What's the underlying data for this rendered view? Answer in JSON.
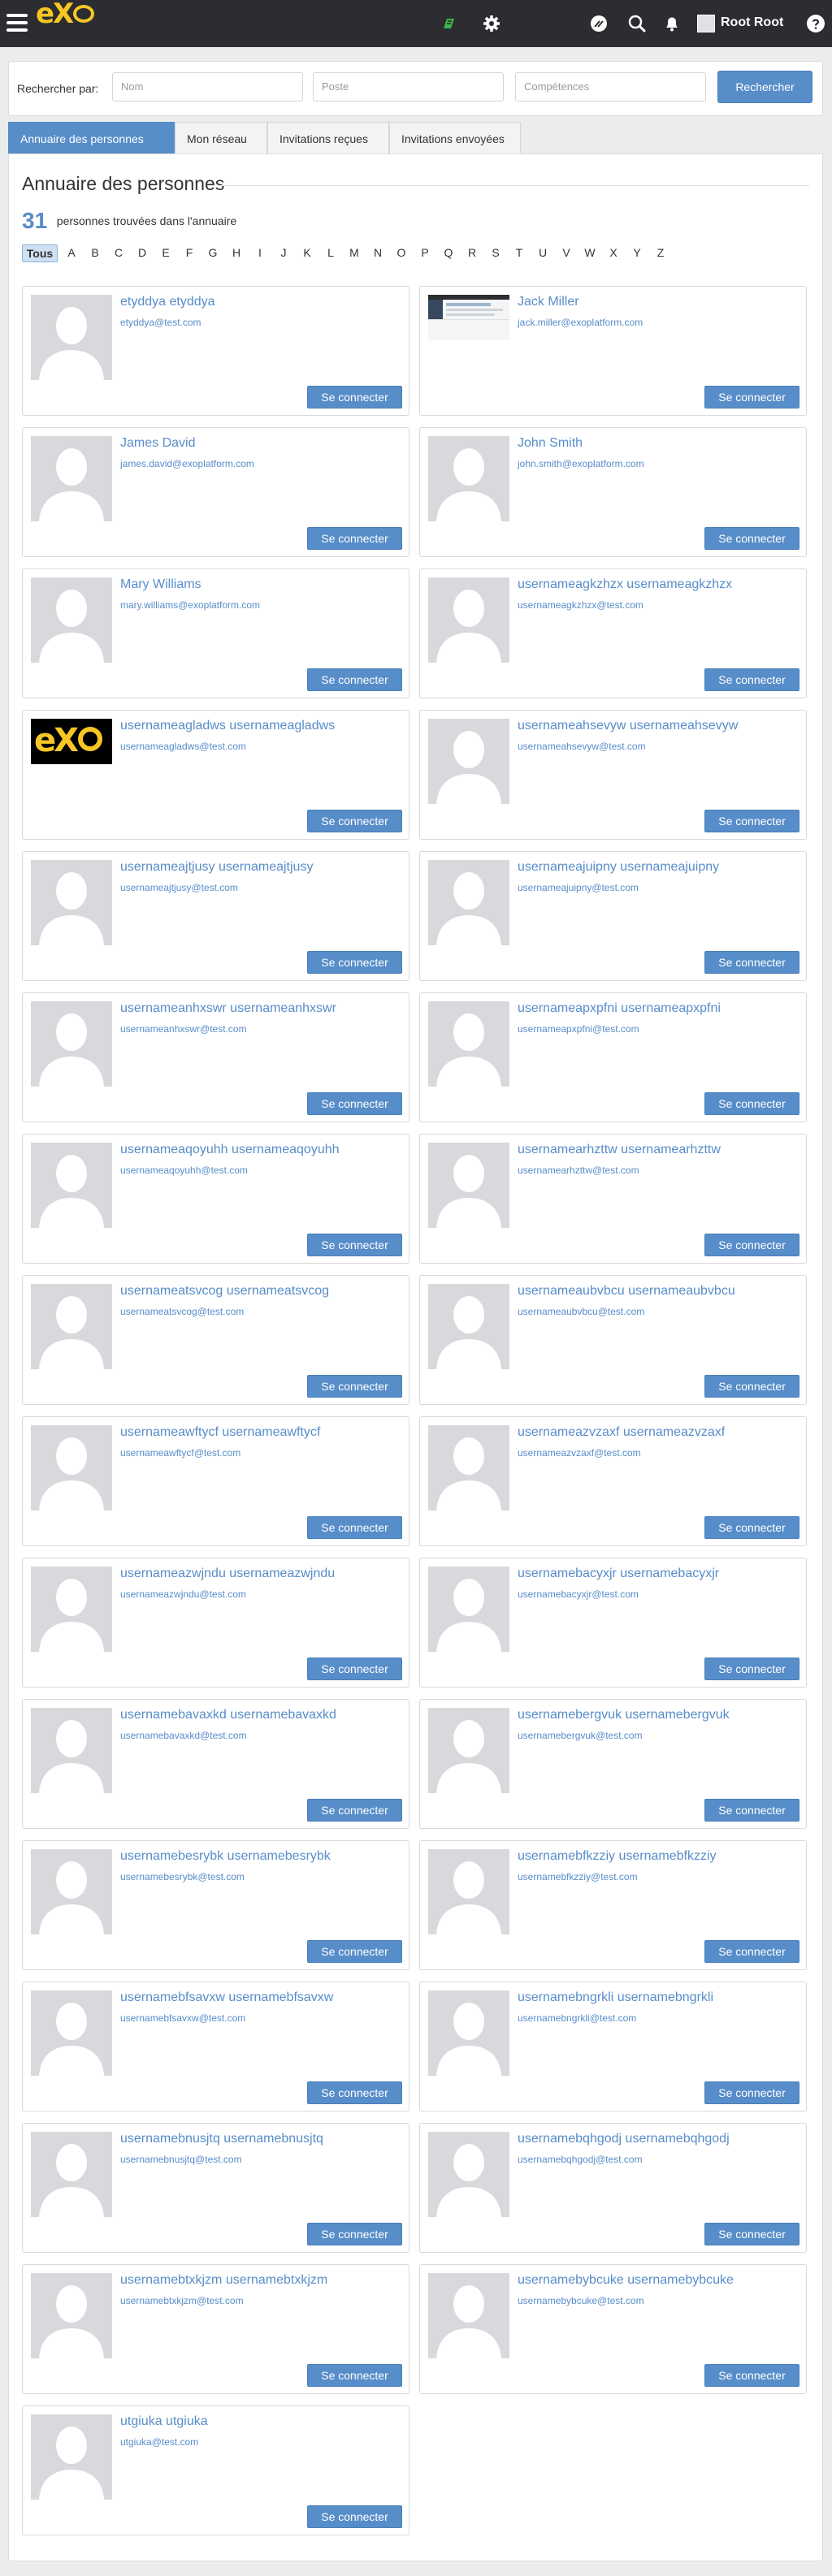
{
  "topbar": {
    "logo_text": "eX",
    "user_name": "Root Root",
    "icons": [
      "menu-icon",
      "app-badge-icon",
      "settings-icon",
      "chat-icon",
      "search-icon",
      "bell-icon",
      "help-icon"
    ],
    "colors": {
      "bar": "#2b2d31",
      "logo": "#f6c624",
      "badge": "#3bb54a"
    }
  },
  "search": {
    "label": "Rechercher par:",
    "name_placeholder": "Nom",
    "position_placeholder": "Poste",
    "skills_placeholder": "Compétences",
    "button_label": "Rechercher"
  },
  "tabs": [
    {
      "label": "Annuaire des personnes",
      "active": true
    },
    {
      "label": "Mon réseau",
      "active": false
    },
    {
      "label": "Invitations reçues",
      "active": false
    },
    {
      "label": "Invitations envoyées",
      "active": false
    }
  ],
  "directory": {
    "title": "Annuaire des personnes",
    "count": "31",
    "count_text": "personnes trouvées dans l'annuaire",
    "letters": [
      "Tous",
      "A",
      "B",
      "C",
      "D",
      "E",
      "F",
      "G",
      "H",
      "I",
      "J",
      "K",
      "L",
      "M",
      "N",
      "O",
      "P",
      "Q",
      "R",
      "S",
      "T",
      "U",
      "V",
      "W",
      "X",
      "Y",
      "Z"
    ],
    "active_letter": "Tous",
    "connect_label": "Se connecter",
    "accent_color": "#578dc9",
    "people": [
      {
        "name": "etyddya etyddya",
        "email": "etyddya@test.com",
        "avatar": "default"
      },
      {
        "name": "Jack Miller",
        "email": "jack.miller@exoplatform.com",
        "avatar": "screenshot"
      },
      {
        "name": "James David",
        "email": "james.david@exoplatform.com",
        "avatar": "default"
      },
      {
        "name": "John Smith",
        "email": "john.smith@exoplatform.com",
        "avatar": "default"
      },
      {
        "name": "Mary Williams",
        "email": "mary.williams@exoplatform.com",
        "avatar": "default"
      },
      {
        "name": "usernameagkzhzx usernameagkzhzx",
        "email": "usernameagkzhzx@test.com",
        "avatar": "default"
      },
      {
        "name": "usernameagladws usernameagladws",
        "email": "usernameagladws@test.com",
        "avatar": "exo-logo"
      },
      {
        "name": "usernameahsevyw usernameahsevyw",
        "email": "usernameahsevyw@test.com",
        "avatar": "default"
      },
      {
        "name": "usernameajtjusy usernameajtjusy",
        "email": "usernameajtjusy@test.com",
        "avatar": "default"
      },
      {
        "name": "usernameajuipny usernameajuipny",
        "email": "usernameajuipny@test.com",
        "avatar": "default"
      },
      {
        "name": "usernameanhxswr usernameanhxswr",
        "email": "usernameanhxswr@test.com",
        "avatar": "default"
      },
      {
        "name": "usernameapxpfni usernameapxpfni",
        "email": "usernameapxpfni@test.com",
        "avatar": "default"
      },
      {
        "name": "usernameaqoyuhh usernameaqoyuhh",
        "email": "usernameaqoyuhh@test.com",
        "avatar": "default"
      },
      {
        "name": "usernamearhzttw usernamearhzttw",
        "email": "usernamearhzttw@test.com",
        "avatar": "default"
      },
      {
        "name": "usernameatsvcog usernameatsvcog",
        "email": "usernameatsvcog@test.com",
        "avatar": "default"
      },
      {
        "name": "usernameaubvbcu usernameaubvbcu",
        "email": "usernameaubvbcu@test.com",
        "avatar": "default"
      },
      {
        "name": "usernameawftycf usernameawftycf",
        "email": "usernameawftycf@test.com",
        "avatar": "default"
      },
      {
        "name": "usernameazvzaxf usernameazvzaxf",
        "email": "usernameazvzaxf@test.com",
        "avatar": "default"
      },
      {
        "name": "usernameazwjndu usernameazwjndu",
        "email": "usernameazwjndu@test.com",
        "avatar": "default"
      },
      {
        "name": "usernamebacyxjr usernamebacyxjr",
        "email": "usernamebacyxjr@test.com",
        "avatar": "default"
      },
      {
        "name": "usernamebavaxkd usernamebavaxkd",
        "email": "usernamebavaxkd@test.com",
        "avatar": "default"
      },
      {
        "name": "usernamebergvuk usernamebergvuk",
        "email": "usernamebergvuk@test.com",
        "avatar": "default"
      },
      {
        "name": "usernamebesrybk usernamebesrybk",
        "email": "usernamebesrybk@test.com",
        "avatar": "default"
      },
      {
        "name": "usernamebfkzziy usernamebfkzziy",
        "email": "usernamebfkzziy@test.com",
        "avatar": "default"
      },
      {
        "name": "usernamebfsavxw usernamebfsavxw",
        "email": "usernamebfsavxw@test.com",
        "avatar": "default"
      },
      {
        "name": "usernamebngrkli usernamebngrkli",
        "email": "usernamebngrkli@test.com",
        "avatar": "default"
      },
      {
        "name": "usernamebnusjtq usernamebnusjtq",
        "email": "usernamebnusjtq@test.com",
        "avatar": "default"
      },
      {
        "name": "usernamebqhgodj usernamebqhgodj",
        "email": "usernamebqhgodj@test.com",
        "avatar": "default"
      },
      {
        "name": "usernamebtxkjzm usernamebtxkjzm",
        "email": "usernamebtxkjzm@test.com",
        "avatar": "default"
      },
      {
        "name": "usernamebybcuke usernamebybcuke",
        "email": "usernamebybcuke@test.com",
        "avatar": "default"
      },
      {
        "name": "utgiuka utgiuka",
        "email": "utgiuka@test.com",
        "avatar": "default"
      }
    ]
  }
}
